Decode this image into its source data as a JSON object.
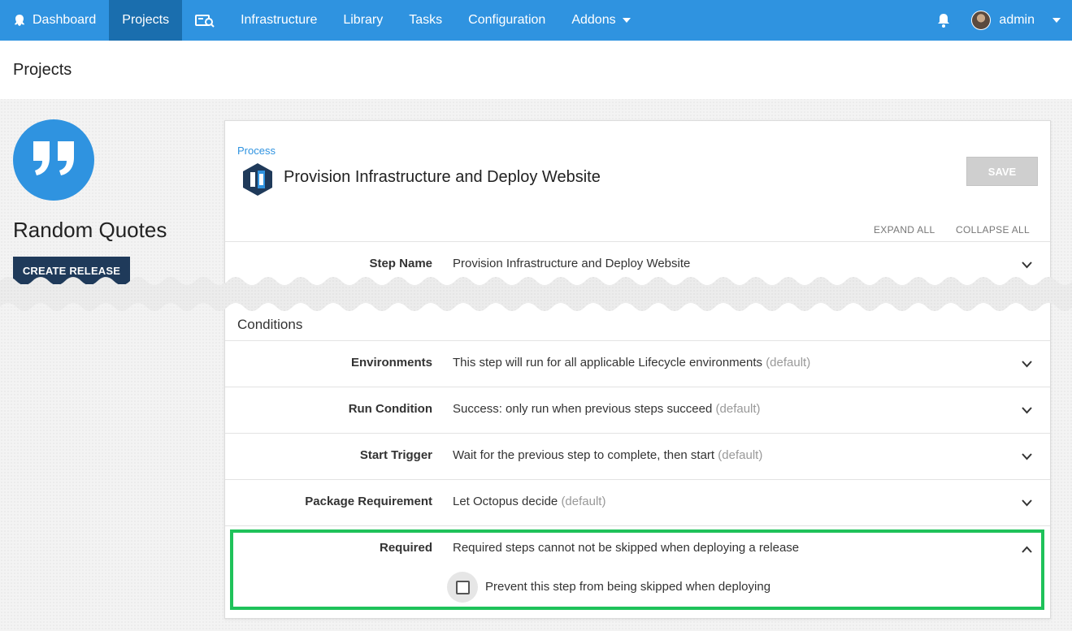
{
  "nav": {
    "dashboard": "Dashboard",
    "projects": "Projects",
    "infrastructure": "Infrastructure",
    "library": "Library",
    "tasks": "Tasks",
    "configuration": "Configuration",
    "addons": "Addons",
    "user": "admin",
    "icons": [
      "octopus-icon",
      "search-icon",
      "chevron-down-icon",
      "bell-icon"
    ]
  },
  "page": {
    "title": "Projects"
  },
  "project": {
    "name": "Random Quotes",
    "create_release": "CREATE RELEASE"
  },
  "process": {
    "breadcrumb": "Process",
    "title": "Provision Infrastructure and Deploy Website",
    "save": "SAVE",
    "expand_all": "EXPAND ALL",
    "collapse_all": "COLLAPSE ALL"
  },
  "step_name": {
    "label": "Step Name",
    "value": "Provision Infrastructure and Deploy Website"
  },
  "conditions_heading": "Conditions",
  "conditions": [
    {
      "label": "Environments",
      "value": "This step will run for all applicable Lifecycle environments",
      "default": "(default)"
    },
    {
      "label": "Run Condition",
      "value": "Success: only run when previous steps succeed",
      "default": "(default)"
    },
    {
      "label": "Start Trigger",
      "value": "Wait for the previous step to complete, then start",
      "default": "(default)"
    },
    {
      "label": "Package Requirement",
      "value": "Let Octopus decide",
      "default": "(default)"
    }
  ],
  "required": {
    "label": "Required",
    "value": "Required steps cannot not be skipped when deploying a release",
    "checkbox_label": "Prevent this step from being skipped when deploying",
    "checked": false
  },
  "colors": {
    "brand": "#2f93e0",
    "nav_active": "#1a6eae",
    "highlight": "#1fc25a",
    "button_dark": "#1f3a5a"
  }
}
